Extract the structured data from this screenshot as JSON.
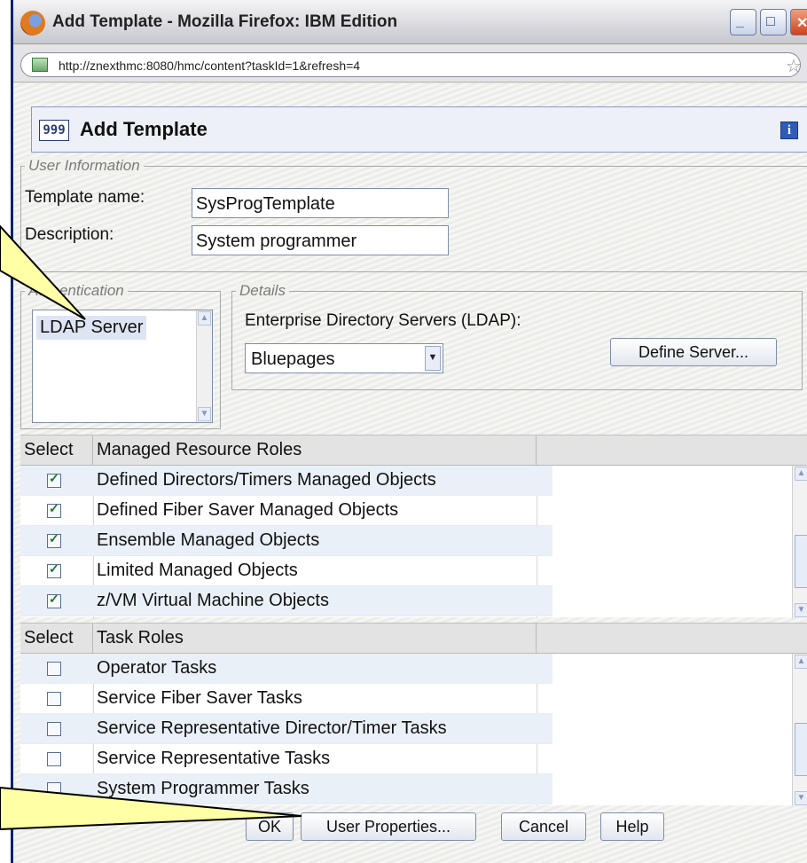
{
  "window": {
    "title": "Add Template - Mozilla Firefox: IBM Edition",
    "url": "http://znexthmc:8080/hmc/content?taskId=1&refresh=4"
  },
  "dialog": {
    "title": "Add Template",
    "header_icon_glyph": "999"
  },
  "user_information": {
    "legend": "User Information",
    "template_name_label": "Template name:",
    "template_name_value": "SysProgTemplate",
    "description_label": "Description:",
    "description_value": "System programmer"
  },
  "authentication": {
    "legend": "Authentication",
    "items": [
      "LDAP Server"
    ]
  },
  "details": {
    "legend": "Details",
    "ldap_label": "Enterprise Directory Servers (LDAP):",
    "ldap_selected": "Bluepages",
    "define_server_label": "Define Server..."
  },
  "managed_resource_roles": {
    "select_header": "Select",
    "name_header": "Managed Resource Roles",
    "rows": [
      {
        "label": "Defined Directors/Timers Managed Objects",
        "checked": true
      },
      {
        "label": "Defined Fiber Saver Managed Objects",
        "checked": true
      },
      {
        "label": "Ensemble Managed Objects",
        "checked": true
      },
      {
        "label": "Limited Managed Objects",
        "checked": true
      },
      {
        "label": "z/VM Virtual Machine Objects",
        "checked": true
      }
    ]
  },
  "task_roles": {
    "select_header": "Select",
    "name_header": "Task Roles",
    "rows": [
      {
        "label": "Operator Tasks",
        "checked": false
      },
      {
        "label": "Service Fiber Saver Tasks",
        "checked": false
      },
      {
        "label": "Service Representative Director/Timer Tasks",
        "checked": false
      },
      {
        "label": "Service Representative Tasks",
        "checked": false
      },
      {
        "label": "System Programmer Tasks",
        "checked": false
      }
    ]
  },
  "buttons": {
    "ok": "OK",
    "user_properties": "User Properties...",
    "cancel": "Cancel",
    "help": "Help"
  },
  "colors": {
    "callout_fill": "#ffffa6",
    "callout_stroke": "#000000",
    "row_alt": "#e9f0f8"
  }
}
